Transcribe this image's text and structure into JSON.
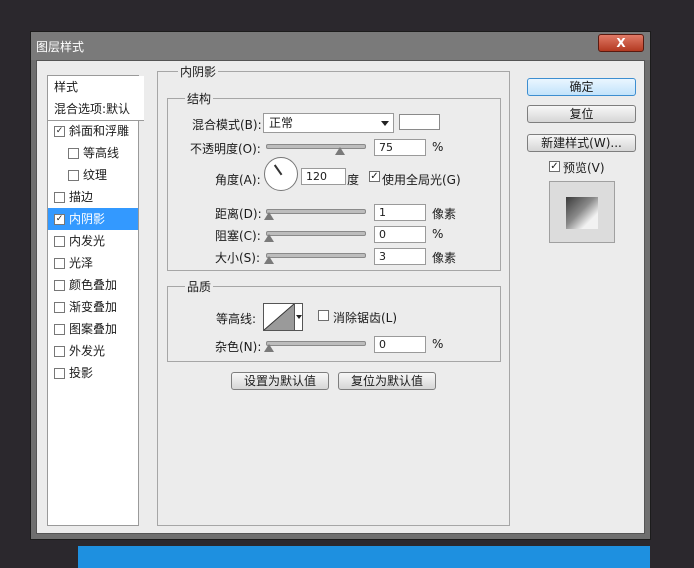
{
  "dialog": {
    "title": "图层样式",
    "close": "X"
  },
  "left_panel": {
    "header1": "样式",
    "header2": "混合选项:默认",
    "items": [
      {
        "label": "斜面和浮雕",
        "checked": true,
        "indent": false
      },
      {
        "label": "等高线",
        "checked": false,
        "indent": true
      },
      {
        "label": "纹理",
        "checked": false,
        "indent": true
      },
      {
        "label": "描边",
        "checked": false,
        "indent": false
      },
      {
        "label": "内阴影",
        "checked": true,
        "indent": false,
        "selected": true
      },
      {
        "label": "内发光",
        "checked": false,
        "indent": false
      },
      {
        "label": "光泽",
        "checked": false,
        "indent": false
      },
      {
        "label": "颜色叠加",
        "checked": false,
        "indent": false
      },
      {
        "label": "渐变叠加",
        "checked": false,
        "indent": false
      },
      {
        "label": "图案叠加",
        "checked": false,
        "indent": false
      },
      {
        "label": "外发光",
        "checked": false,
        "indent": false
      },
      {
        "label": "投影",
        "checked": false,
        "indent": false
      }
    ]
  },
  "main": {
    "section_title": "内阴影",
    "structure": {
      "legend": "结构",
      "blend_mode_label": "混合模式(B):",
      "blend_mode_value": "正常",
      "opacity_label": "不透明度(O):",
      "opacity_value": "75",
      "opacity_unit": "%",
      "opacity_level": 0.75,
      "angle_label": "角度(A):",
      "angle_value": "120",
      "angle_unit": "度",
      "global_light_label": "使用全局光(G)",
      "global_light_checked": true,
      "distance_label": "距离(D):",
      "distance_value": "1",
      "distance_unit": "像素",
      "choke_label": "阻塞(C):",
      "choke_value": "0",
      "choke_unit": "%",
      "size_label": "大小(S):",
      "size_value": "3",
      "size_unit": "像素"
    },
    "quality": {
      "legend": "品质",
      "contour_label": "等高线:",
      "antialias_label": "消除锯齿(L)",
      "antialias_checked": false,
      "noise_label": "杂色(N):",
      "noise_value": "0",
      "noise_unit": "%"
    },
    "buttons": {
      "set_default": "设置为默认值",
      "reset_default": "复位为默认值"
    }
  },
  "right": {
    "ok": "确定",
    "reset": "复位",
    "new_style": "新建样式(W)...",
    "preview_label": "预览(V)",
    "preview_checked": true
  }
}
